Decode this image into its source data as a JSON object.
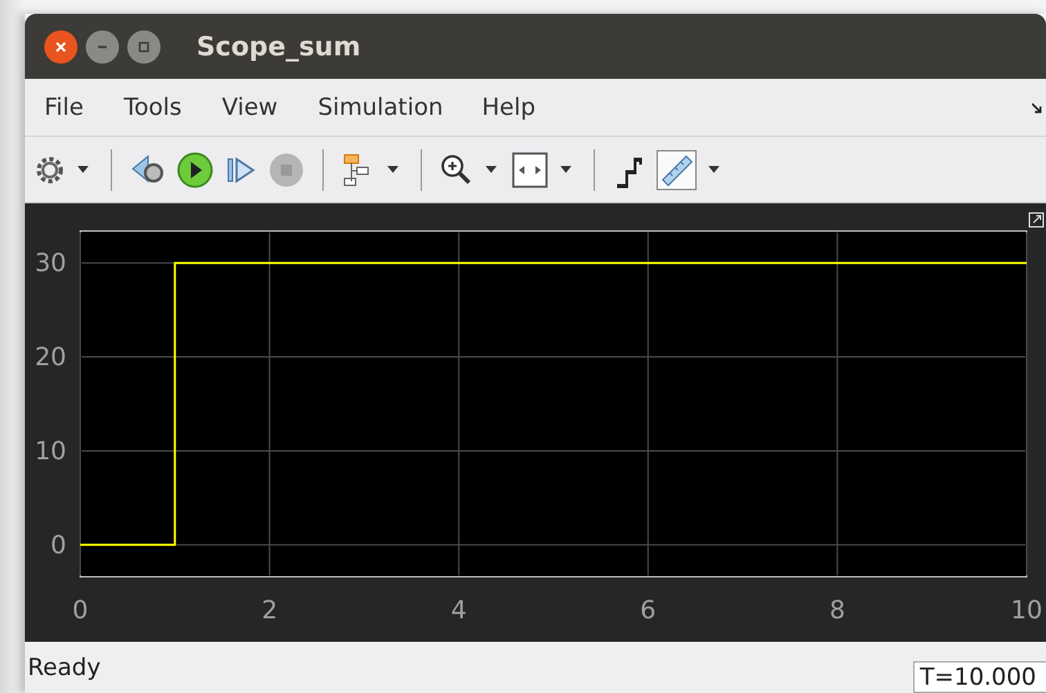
{
  "window": {
    "title": "Scope_sum",
    "controls": [
      {
        "kind": "close"
      },
      {
        "kind": "minimize"
      },
      {
        "kind": "maximize"
      }
    ]
  },
  "menu": [
    "File",
    "Tools",
    "View",
    "Simulation",
    "Help"
  ],
  "toolbar": [
    {
      "kind": "gear",
      "dropdown": true
    },
    {
      "kind": "separator"
    },
    {
      "kind": "step-back",
      "dropdown": false
    },
    {
      "kind": "run",
      "dropdown": false
    },
    {
      "kind": "step-forward",
      "dropdown": false
    },
    {
      "kind": "stop",
      "dropdown": false,
      "disabled": true
    },
    {
      "kind": "separator"
    },
    {
      "kind": "highlight",
      "dropdown": true
    },
    {
      "kind": "separator"
    },
    {
      "kind": "zoom",
      "dropdown": true
    },
    {
      "kind": "fit",
      "dropdown": true
    },
    {
      "kind": "separator"
    },
    {
      "kind": "style",
      "dropdown": false
    },
    {
      "kind": "ruler",
      "dropdown": true
    }
  ],
  "plot": {
    "chart_data": {
      "type": "line",
      "x": [
        0,
        1,
        1,
        10
      ],
      "series": [
        {
          "color": "#ffff00",
          "values": [
            0,
            0,
            30,
            30
          ]
        }
      ],
      "xlim": [
        0,
        10
      ],
      "ylim": [
        -3.4,
        33.4
      ],
      "xticks": [
        0,
        2,
        4,
        6,
        8,
        10
      ],
      "yticks": [
        0,
        10,
        20,
        30
      ],
      "grid": true
    }
  },
  "status_bar": {
    "message": "Ready",
    "time": "T=10.000"
  }
}
